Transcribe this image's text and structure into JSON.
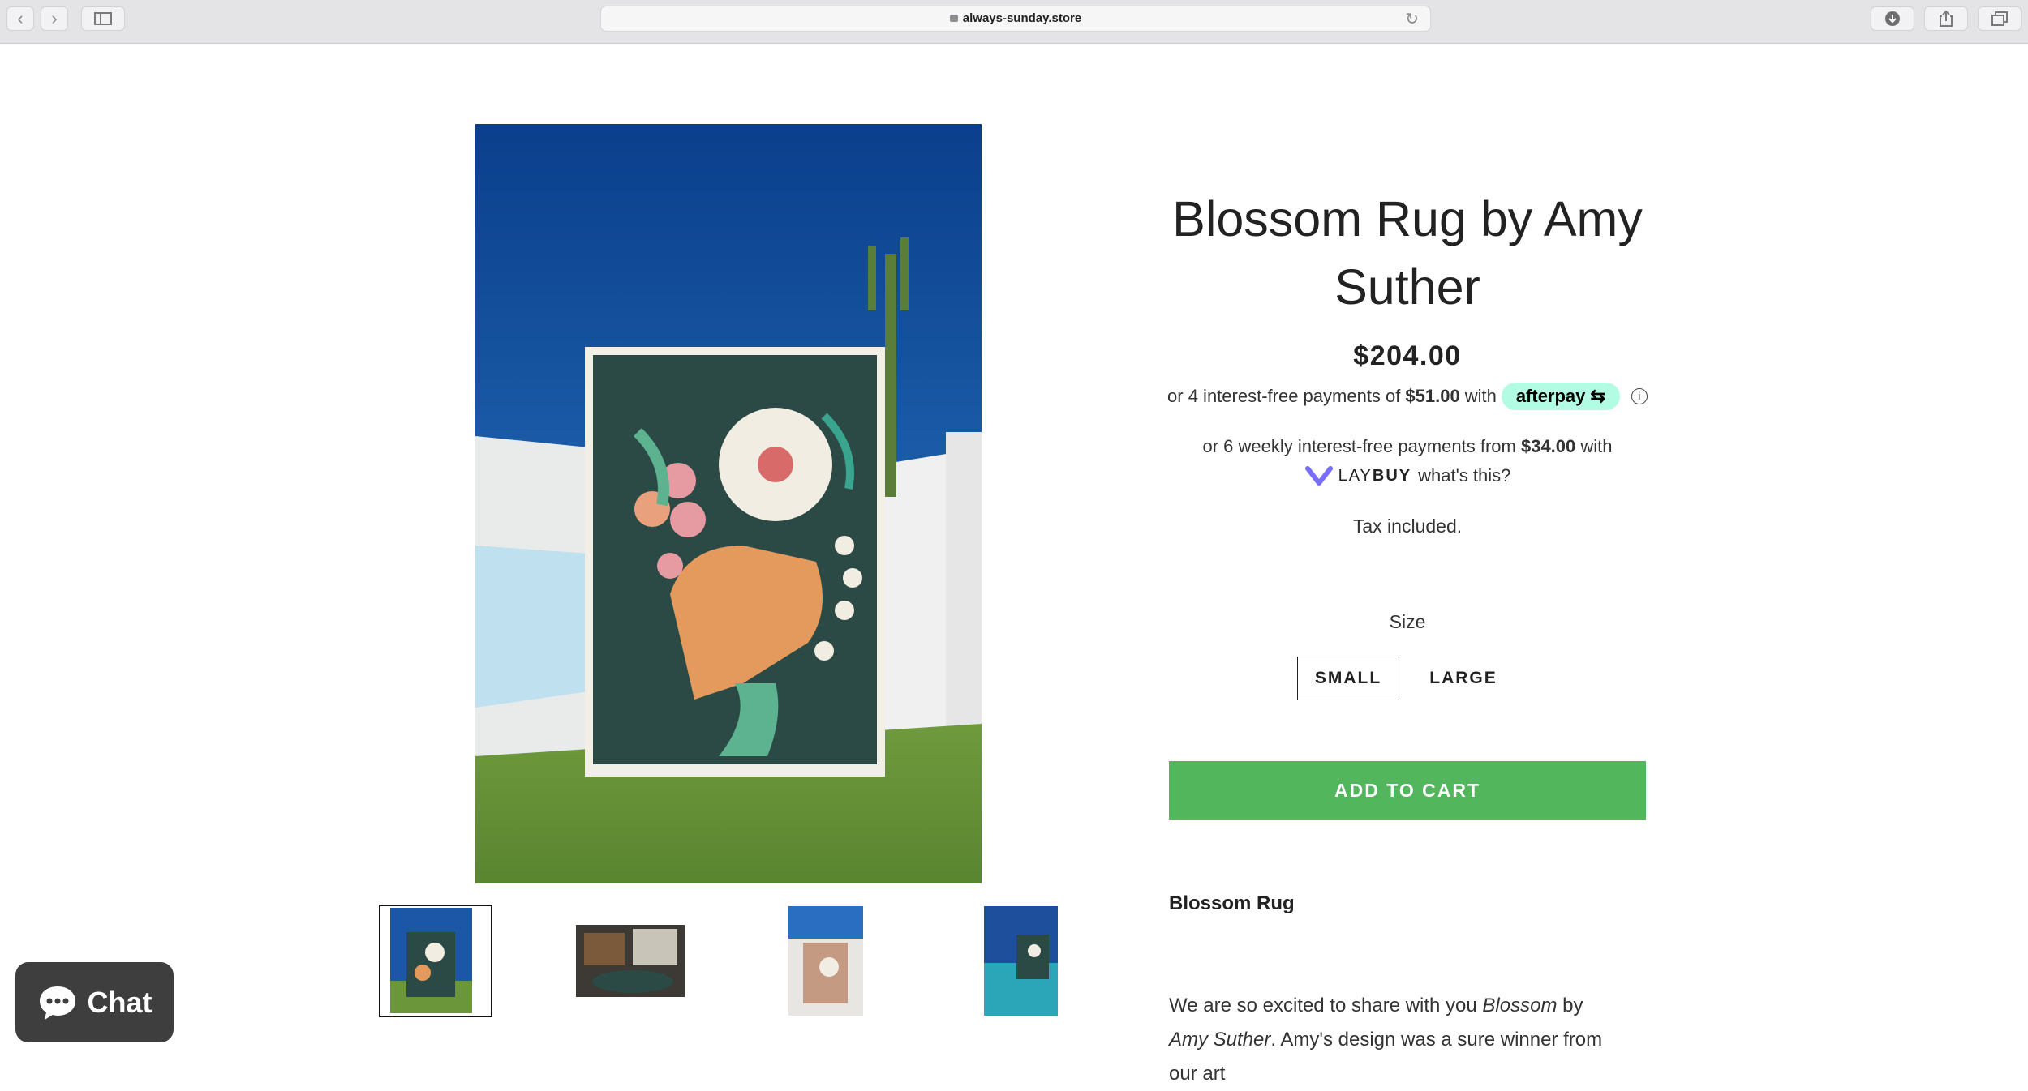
{
  "browser": {
    "url": "always-sunday.store",
    "back_icon": "chevron-left-icon",
    "forward_icon": "chevron-right-icon",
    "sidebar_icon": "sidebar-icon",
    "reload_icon": "reload-icon",
    "download_icon": "download-icon",
    "share_icon": "share-icon",
    "tabs_icon": "tabs-icon"
  },
  "product": {
    "title": "Blossom Rug by Amy Suther",
    "price": "$204.00",
    "afterpay": {
      "prefix": "or 4 interest-free payments of",
      "amount": "$51.00",
      "suffix": "with",
      "brand": "afterpay"
    },
    "laybuy": {
      "prefix": "or 6 weekly interest-free payments from",
      "amount": "$34.00",
      "suffix": "with",
      "brand_lay": "LAY",
      "brand_buy": "BUY",
      "link": "what's this?"
    },
    "tax_note": "Tax included.",
    "size_label": "Size",
    "sizes": [
      "SMALL",
      "LARGE"
    ],
    "selected_size": "SMALL",
    "add_to_cart": "ADD TO CART",
    "description_title": "Blossom Rug",
    "description": {
      "part1": "We are so excited to share with you ",
      "italic1": "Blossom",
      "part2": " by ",
      "italic2": "Amy Suther",
      "part3": ". Amy's design was a sure winner from our art"
    }
  },
  "chat": {
    "label": "Chat"
  },
  "colors": {
    "add_to_cart": "#52b65c",
    "afterpay": "#b2fce4",
    "laybuy_heart": "#786dff",
    "chat_bg": "#3e3e3e"
  }
}
